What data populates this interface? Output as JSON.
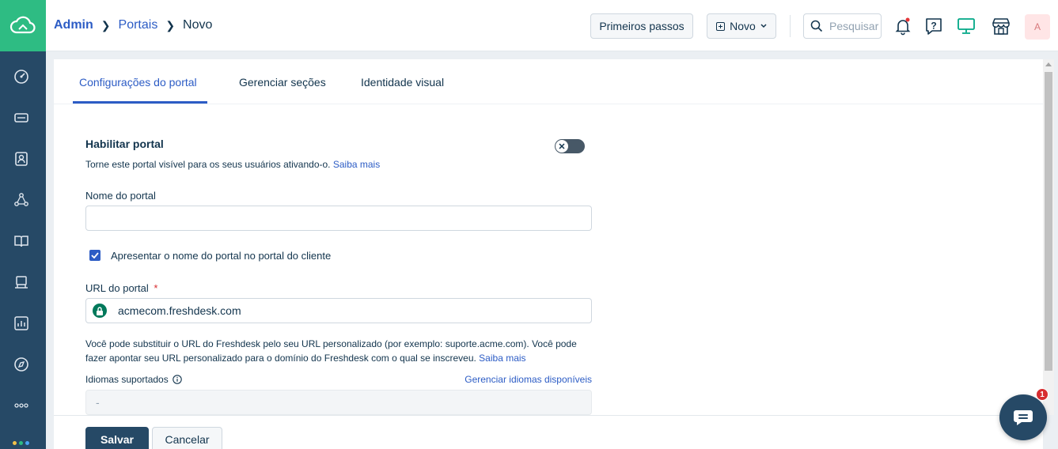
{
  "breadcrumb": {
    "admin": "Admin",
    "portais": "Portais",
    "novo": "Novo"
  },
  "header": {
    "primeiros_passos": "Primeiros passos",
    "novo_button": "Novo",
    "search_placeholder": "Pesquisar",
    "avatar_initial": "A"
  },
  "tabs": [
    {
      "label": "Configurações do portal"
    },
    {
      "label": "Gerenciar seções"
    },
    {
      "label": "Identidade visual"
    }
  ],
  "form": {
    "enable_title": "Habilitar portal",
    "enable_desc": "Torne este portal visível para os seus usuários ativando-o.",
    "saiba_mais": "Saiba mais",
    "toggle_state": "off",
    "portal_name_label": "Nome do portal",
    "portal_name_value": "",
    "show_name_label": "Apresentar o nome do portal no portal do cliente",
    "show_name_checked": true,
    "url_label": "URL do portal",
    "url_required": "*",
    "url_value": "acmecom.freshdesk.com",
    "url_desc": "Você pode substituir o URL do Freshdesk pelo seu URL personalizado (por exemplo: suporte.acme.com). Você pode fazer apontar seu URL personalizado para o domínio do Freshdesk com o qual se inscreveu.",
    "url_saiba_mais": "Saiba mais",
    "languages_label": "Idiomas suportados",
    "manage_languages": "Gerenciar idiomas disponíveis",
    "languages_value": "-"
  },
  "footer": {
    "save": "Salvar",
    "cancel": "Cancelar"
  },
  "chat": {
    "badge_count": "1"
  },
  "colors": {
    "sidebar": "#264966",
    "logo_bg": "#2ebc83",
    "link": "#2c5cc5",
    "lock_green": "#00795b",
    "badge_red": "#d72d30"
  }
}
